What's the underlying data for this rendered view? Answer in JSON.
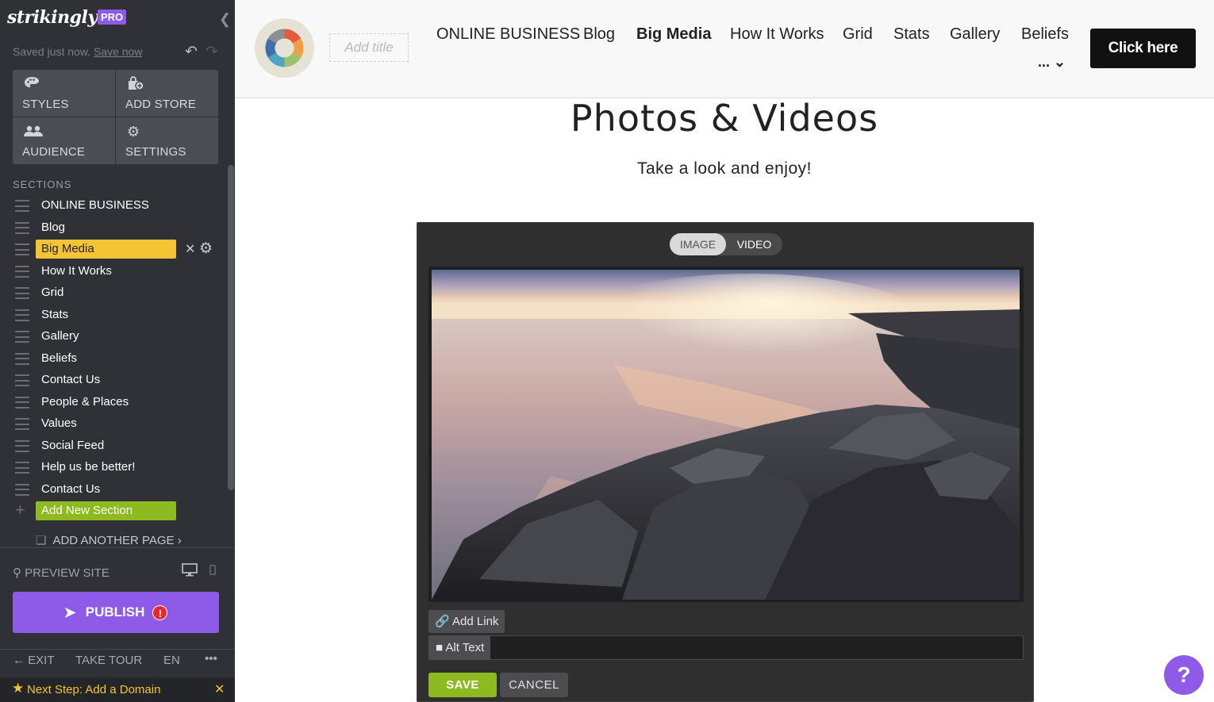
{
  "editor": {
    "brand": "strikingly",
    "plan_badge": "PRO",
    "saved_text": "Saved just now.",
    "save_now_link": "Save now",
    "tiles": [
      {
        "label": "STYLES",
        "icon": "palette-icon"
      },
      {
        "label": "ADD STORE",
        "icon": "store-icon"
      },
      {
        "label": "AUDIENCE",
        "icon": "people-icon"
      },
      {
        "label": "SETTINGS",
        "icon": "gear-icon"
      }
    ],
    "sections_heading": "SECTIONS",
    "sections": [
      {
        "label": "ONLINE BUSINESS"
      },
      {
        "label": "Blog"
      },
      {
        "label": "Big Media"
      },
      {
        "label": "How It Works"
      },
      {
        "label": "Grid"
      },
      {
        "label": "Stats"
      },
      {
        "label": "Gallery"
      },
      {
        "label": "Beliefs"
      },
      {
        "label": "Contact Us"
      },
      {
        "label": "People & Places"
      },
      {
        "label": "Values"
      },
      {
        "label": "Social Feed"
      },
      {
        "label": "Help us be better!"
      },
      {
        "label": "Contact Us"
      }
    ],
    "active_section": "Big Media",
    "add_section_label": "Add New Section",
    "add_page_label": "ADD ANOTHER PAGE",
    "preview_label": "PREVIEW SITE",
    "publish_label": "PUBLISH",
    "publish_alert": "!",
    "footer": {
      "exit": "EXIT",
      "tour": "TAKE TOUR",
      "lang": "EN",
      "more": "•••"
    },
    "next_step": "Next Step: Add a Domain",
    "colors": {
      "sidebar_bg": "#2f3136",
      "accent_purple": "#8e5ae8",
      "active_yellow": "#f4c434",
      "add_green": "#8dba20"
    }
  },
  "site": {
    "add_title_placeholder": "Add title",
    "nav": [
      "ONLINE BUSINESS",
      "Blog",
      "Big Media",
      "How It Works",
      "Grid",
      "Stats",
      "Gallery",
      "Beliefs"
    ],
    "nav_active": "Big Media",
    "nav_more": "...",
    "cta_button": "Click here",
    "section_title": "Photos & Videos",
    "section_subtitle": "Take a look and enjoy!"
  },
  "media_editor": {
    "toggle_image": "IMAGE",
    "toggle_video": "VIDEO",
    "selected_mode": "IMAGE",
    "add_link_label": "Add Link",
    "alt_text_label": "Alt Text",
    "alt_text_value": "",
    "save_label": "SAVE",
    "cancel_label": "CANCEL"
  },
  "help_button": "?"
}
